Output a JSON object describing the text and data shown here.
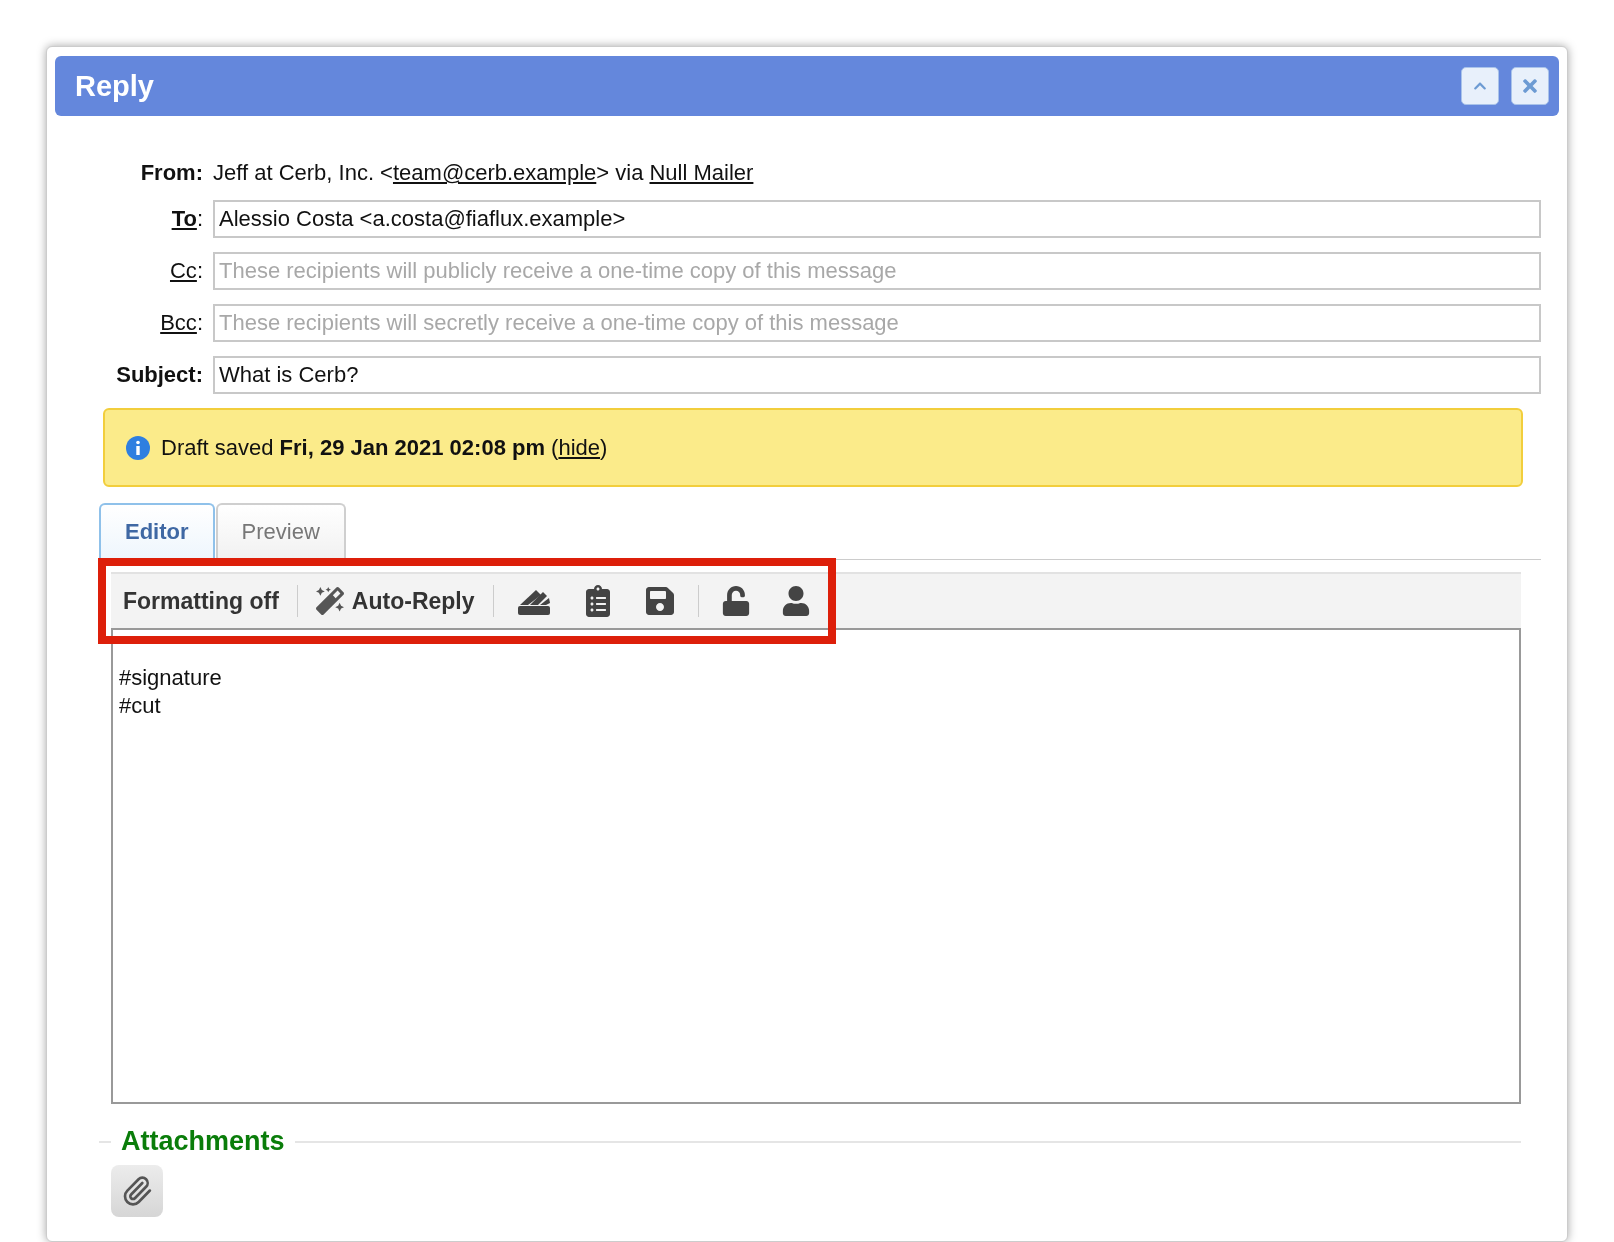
{
  "window": {
    "title": "Reply"
  },
  "from": {
    "label": "From:",
    "parts": [
      {
        "kind": "text",
        "text": "Jeff at Cerb, Inc. <"
      },
      {
        "kind": "link",
        "text": "team@cerb.example"
      },
      {
        "kind": "text",
        "text": "> via "
      },
      {
        "kind": "link",
        "text": "Null Mailer"
      }
    ]
  },
  "fields": [
    {
      "kind": "link",
      "label": "To",
      "suffix": ":",
      "bold": true,
      "value": "Alessio Costa <a.costa@fiaflux.example>"
    },
    {
      "kind": "link",
      "label": "Cc",
      "suffix": ":",
      "bold": false,
      "placeholder": "These recipients will publicly receive a one-time copy of this message"
    },
    {
      "kind": "link",
      "label": "Bcc",
      "suffix": ":",
      "bold": false,
      "placeholder": "These recipients will secretly receive a one-time copy of this message"
    },
    {
      "kind": "plain",
      "label": "Subject:",
      "bold": true,
      "value": "What is Cerb?"
    }
  ],
  "notice": {
    "text": "Draft saved **Fri, 29 Jan 2021 02:08 pm** (",
    "link": "hide",
    "after": ")"
  },
  "tabs": [
    {
      "label": "Editor",
      "selected": true
    },
    {
      "label": "Preview",
      "selected": false
    }
  ],
  "toolbar": {
    "formatting": "Formatting off",
    "auto_reply": "Auto-Reply"
  },
  "editor": {
    "value": "\n#signature\n#cut"
  },
  "attachments": {
    "title": "Attachments"
  }
}
